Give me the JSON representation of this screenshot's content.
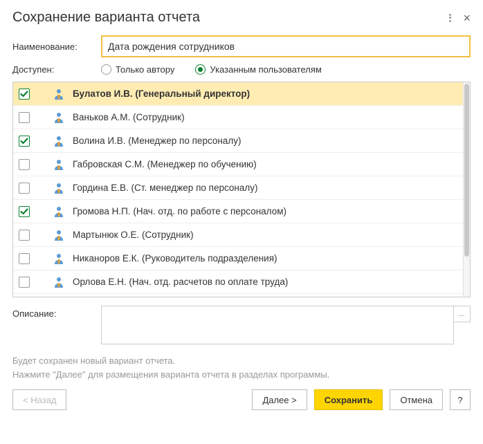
{
  "title": "Сохранение варианта отчета",
  "labels": {
    "name": "Наименование:",
    "available": "Доступен:",
    "description": "Описание:"
  },
  "name_value": "Дата рождения сотрудников",
  "availability": {
    "author_only": "Только автору",
    "specified_users": "Указанным пользователям",
    "selected": "specified_users"
  },
  "users": [
    {
      "checked": true,
      "selected": true,
      "name": "Булатов И.В. (Генеральный директор)"
    },
    {
      "checked": false,
      "selected": false,
      "name": "Ваньков А.М. (Сотрудник)"
    },
    {
      "checked": true,
      "selected": false,
      "name": "Волина И.В. (Менеджер по персоналу)"
    },
    {
      "checked": false,
      "selected": false,
      "name": "Габровская С.М. (Менеджер по обучению)"
    },
    {
      "checked": false,
      "selected": false,
      "name": "Гордина Е.В. (Ст. менеджер по персоналу)"
    },
    {
      "checked": true,
      "selected": false,
      "name": "Громова Н.П. (Нач. отд. по работе с персоналом)"
    },
    {
      "checked": false,
      "selected": false,
      "name": "Мартынюк О.Е. (Сотрудник)"
    },
    {
      "checked": false,
      "selected": false,
      "name": "Никаноров Е.К. (Руководитель подразделения)"
    },
    {
      "checked": false,
      "selected": false,
      "name": "Орлова Е.Н. (Нач. отд. расчетов по оплате труда)"
    }
  ],
  "description_value": "",
  "info_line1": "Будет сохранен новый вариант отчета.",
  "info_line2": "Нажмите \"Далее\" для размещения варианта отчета в разделах программы.",
  "buttons": {
    "back": "<  Назад",
    "next": "Далее  >",
    "save": "Сохранить",
    "cancel": "Отмена",
    "help": "?"
  }
}
